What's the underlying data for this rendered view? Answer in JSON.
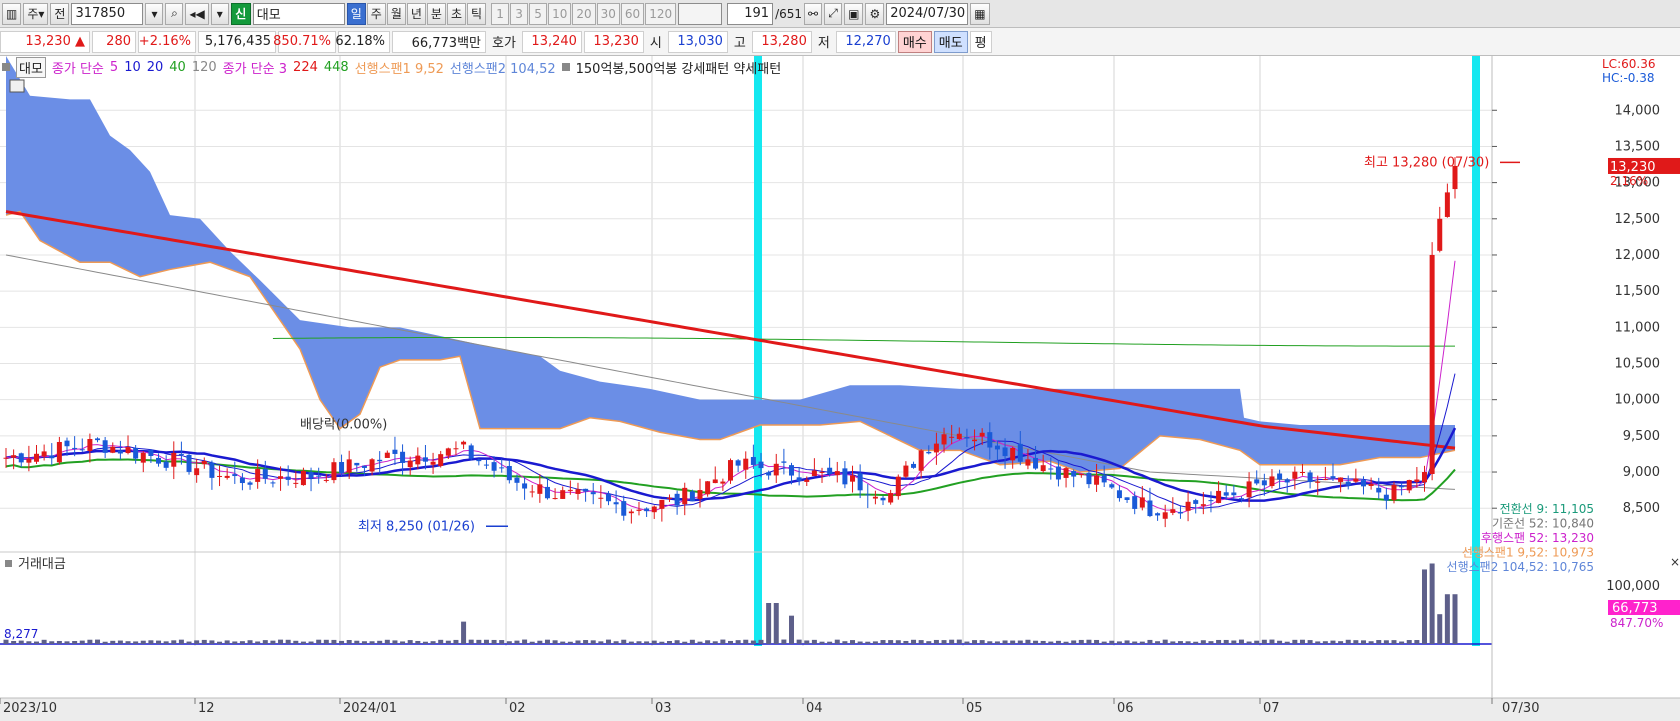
{
  "toolbar": {
    "chart_type": "주",
    "prev_label": "전",
    "code": "317850",
    "market_badge": "신",
    "stock_name": "대모",
    "periods": [
      "일",
      "주",
      "월",
      "년",
      "분",
      "초",
      "틱"
    ],
    "active_period": "일",
    "intervals": [
      "1",
      "3",
      "5",
      "10",
      "20",
      "30",
      "60",
      "120"
    ],
    "count": "191",
    "total": "/651",
    "date": "2024/07/30"
  },
  "quote": {
    "price": "13,230",
    "arrow": "▲",
    "change": "280",
    "change_pct": "+2.16%",
    "volume": "5,176,435",
    "vol_ratio": "850.71%",
    "turnover": "62.18%",
    "amount": "66,773백만",
    "bid_label": "호가",
    "bid1": "13,240",
    "bid2": "13,230",
    "open_label": "시",
    "open": "13,030",
    "high_label": "고",
    "high": "13,280",
    "low_label": "저",
    "low": "12,270",
    "buy_label": "매수",
    "sell_label": "매도",
    "eval_label": "평"
  },
  "legend": {
    "name": "대모",
    "ma_main_label": "종가 단순",
    "ma_main": [
      {
        "v": "5",
        "color": "#cc22cc"
      },
      {
        "v": "10",
        "color": "#1a1ad0"
      },
      {
        "v": "20",
        "color": "#1a1ad0"
      },
      {
        "v": "40",
        "color": "#22a022"
      },
      {
        "v": "120",
        "color": "#888888"
      }
    ],
    "ma2_label": "종가 단순 3",
    "ma2": [
      {
        "v": "224",
        "color": "#e01919"
      },
      {
        "v": "448",
        "color": "#22a022"
      }
    ],
    "span1": "선행스팬1 9,52",
    "span2": "선행스팬2 104,52",
    "pattern": "150억봉,500억봉 강세패턴  약세패턴"
  },
  "side": {
    "lc": "LC:60.36",
    "hc": "HC:-0.38",
    "last_price": "13,230",
    "last_pct": "2.16%",
    "vol_last": "66,773",
    "vol_pct": "847.70%",
    "vol_first": "8,277",
    "vol_tick": "100,000"
  },
  "annotations": {
    "high": "최고 13,280 (07/30)",
    "low": "최저 8,250 (01/26)",
    "dividend": "배당락(0.00%)"
  },
  "ichimoku_labels": [
    {
      "text": "전환선 9: 11,105",
      "color": "#1a9a7a"
    },
    {
      "text": "기준선 52: 10,840",
      "color": "#777777"
    },
    {
      "text": "후행스팬 52: 13,230",
      "color": "#cc22cc"
    },
    {
      "text": "선행스팬1 9,52: 10,973",
      "color": "#ee9a55"
    },
    {
      "text": "선행스팬2 104,52: 10,765",
      "color": "#5f86d8"
    }
  ],
  "volume_title": "거래대금",
  "chart_data": {
    "type": "candlestick",
    "x_labels": [
      "2023/10",
      "12",
      "2024/01",
      "02",
      "03",
      "04",
      "05",
      "06",
      "07",
      "07/30"
    ],
    "y_ticks": [
      8500,
      9000,
      9500,
      10000,
      10500,
      11000,
      11500,
      12000,
      12500,
      13000,
      13500,
      14000
    ],
    "ylim": [
      7950,
      14750
    ],
    "highlight_months": [
      "03",
      "07"
    ],
    "colors": {
      "up": "#e01919",
      "down": "#1a5ad8",
      "cloud": "#6b8ee6",
      "ma224": "#e01919"
    },
    "series": [
      {
        "name": "5",
        "color": "#cc22cc"
      },
      {
        "name": "10",
        "color": "#1a1ad0"
      },
      {
        "name": "20",
        "color": "#1a1ad0"
      },
      {
        "name": "40",
        "color": "#22a022"
      },
      {
        "name": "120",
        "color": "#888888"
      },
      {
        "name": "224",
        "color": "#e01919"
      },
      {
        "name": "448",
        "color": "#22a022"
      },
      {
        "name": "선행스팬1 9,52",
        "color": "#ee9a55"
      },
      {
        "name": "선행스팬2 104,52",
        "color": "#5f86d8"
      }
    ],
    "current_price": 13230,
    "high": 13280,
    "low": 8250
  }
}
